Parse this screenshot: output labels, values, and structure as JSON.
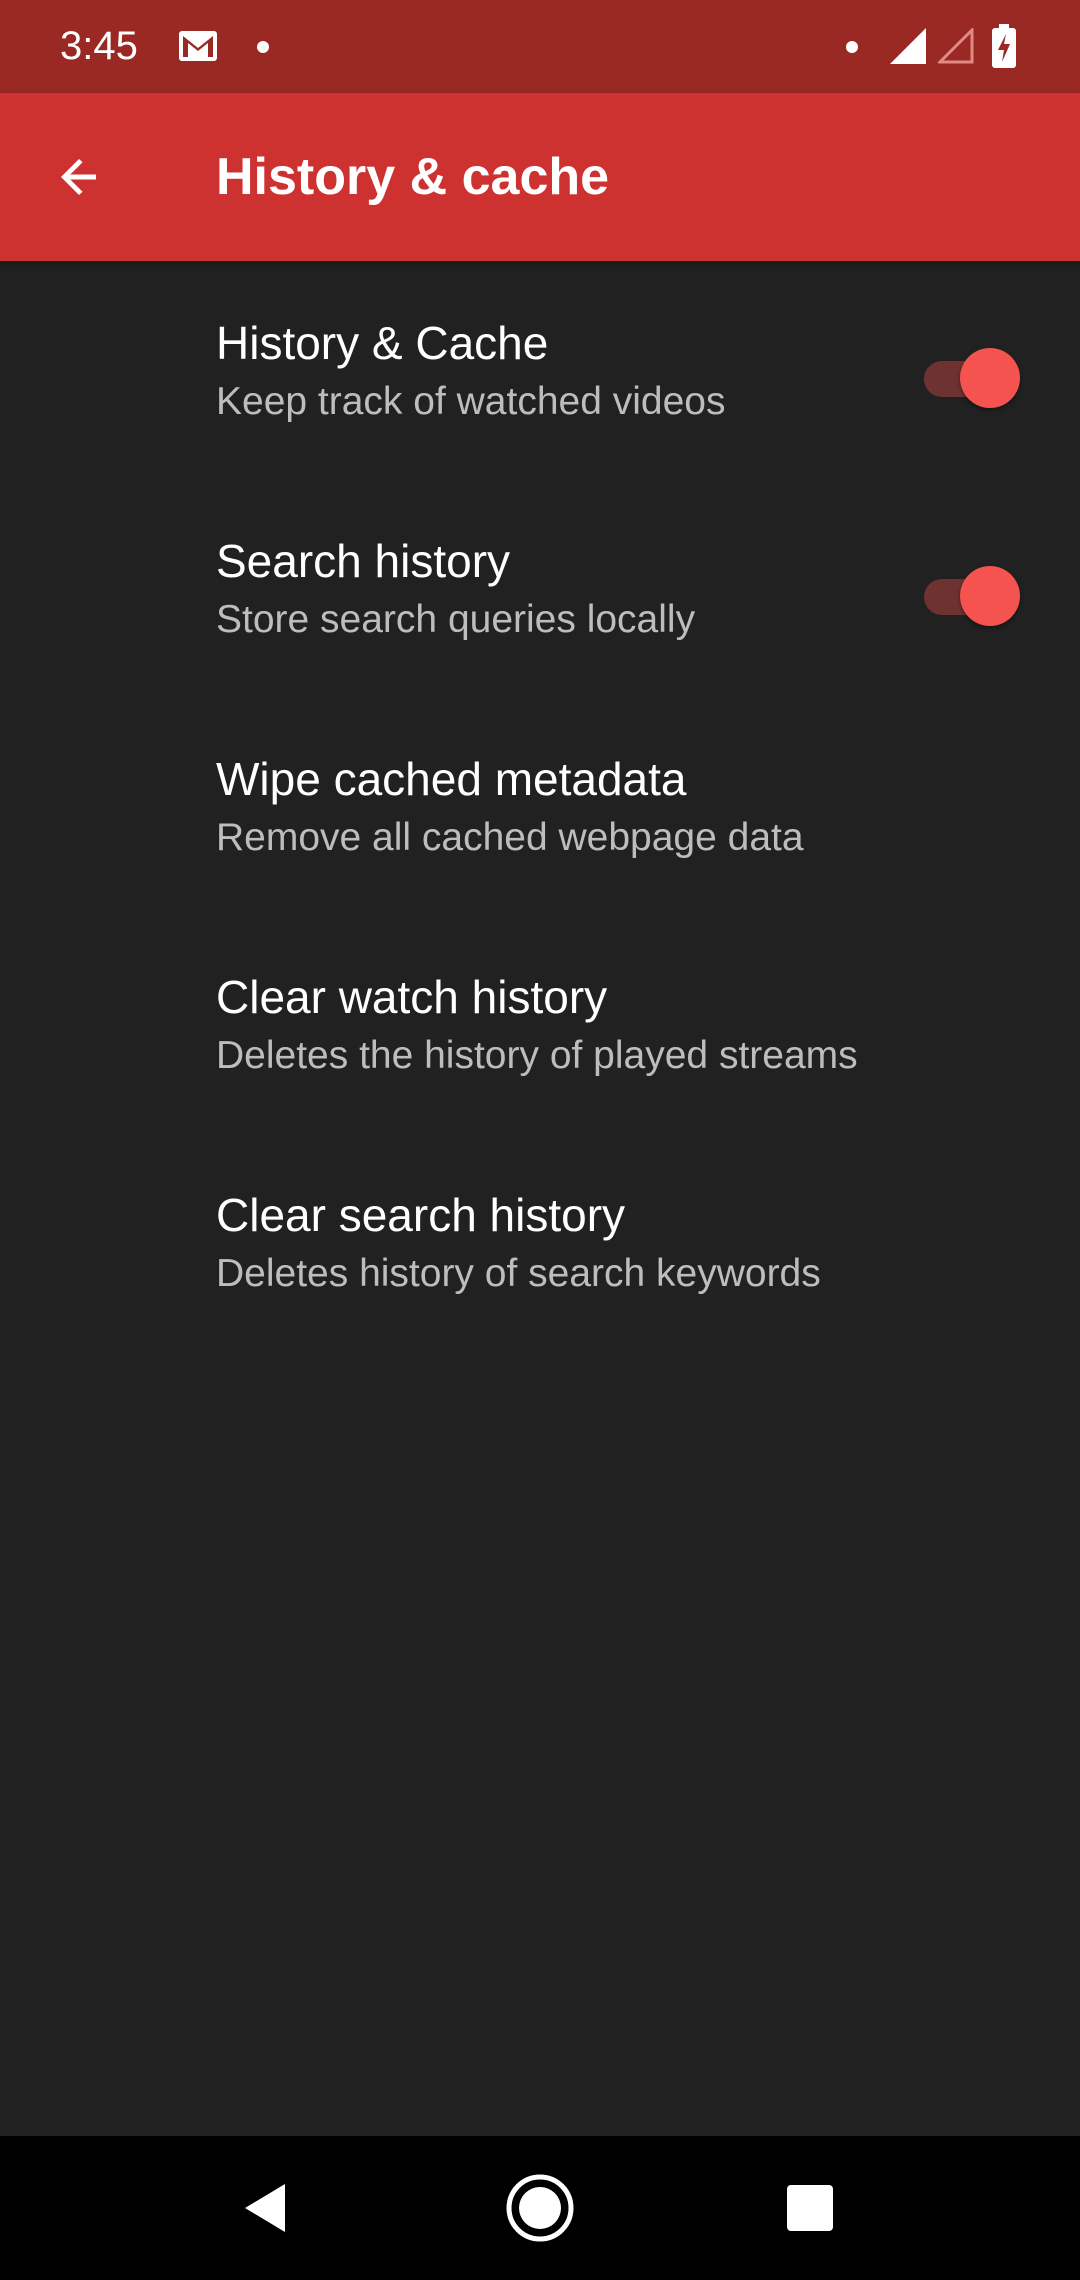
{
  "status_bar": {
    "time": "3:45",
    "left_icons": [
      "gmail-icon",
      "notification-dot-icon"
    ],
    "right_icons": [
      "notification-dot-icon",
      "cell-signal-icon",
      "cell-signal-empty-icon",
      "battery-charging-icon"
    ]
  },
  "app_bar": {
    "title": "History & cache",
    "back_icon": "arrow-back-icon",
    "background": "#CD3230"
  },
  "preferences": [
    {
      "title": "History & Cache",
      "summary": "Keep track of watched videos",
      "type": "switch",
      "checked": true
    },
    {
      "title": "Search history",
      "summary": "Store search queries locally",
      "type": "switch",
      "checked": true
    },
    {
      "title": "Wipe cached metadata",
      "summary": "Remove all cached webpage data",
      "type": "action"
    },
    {
      "title": "Clear watch history",
      "summary": "Deletes the history of played streams",
      "type": "action"
    },
    {
      "title": "Clear search history",
      "summary": "Deletes history of search keywords",
      "type": "action"
    }
  ],
  "nav_bar": {
    "buttons": [
      "back-triangle-icon",
      "home-circle-icon",
      "recents-square-icon"
    ]
  },
  "colors": {
    "status_bar": "#9A2823",
    "accent": "#F45350",
    "background": "#212121",
    "text_primary": "#FFFFFF",
    "text_secondary": "#BDBDBD"
  }
}
